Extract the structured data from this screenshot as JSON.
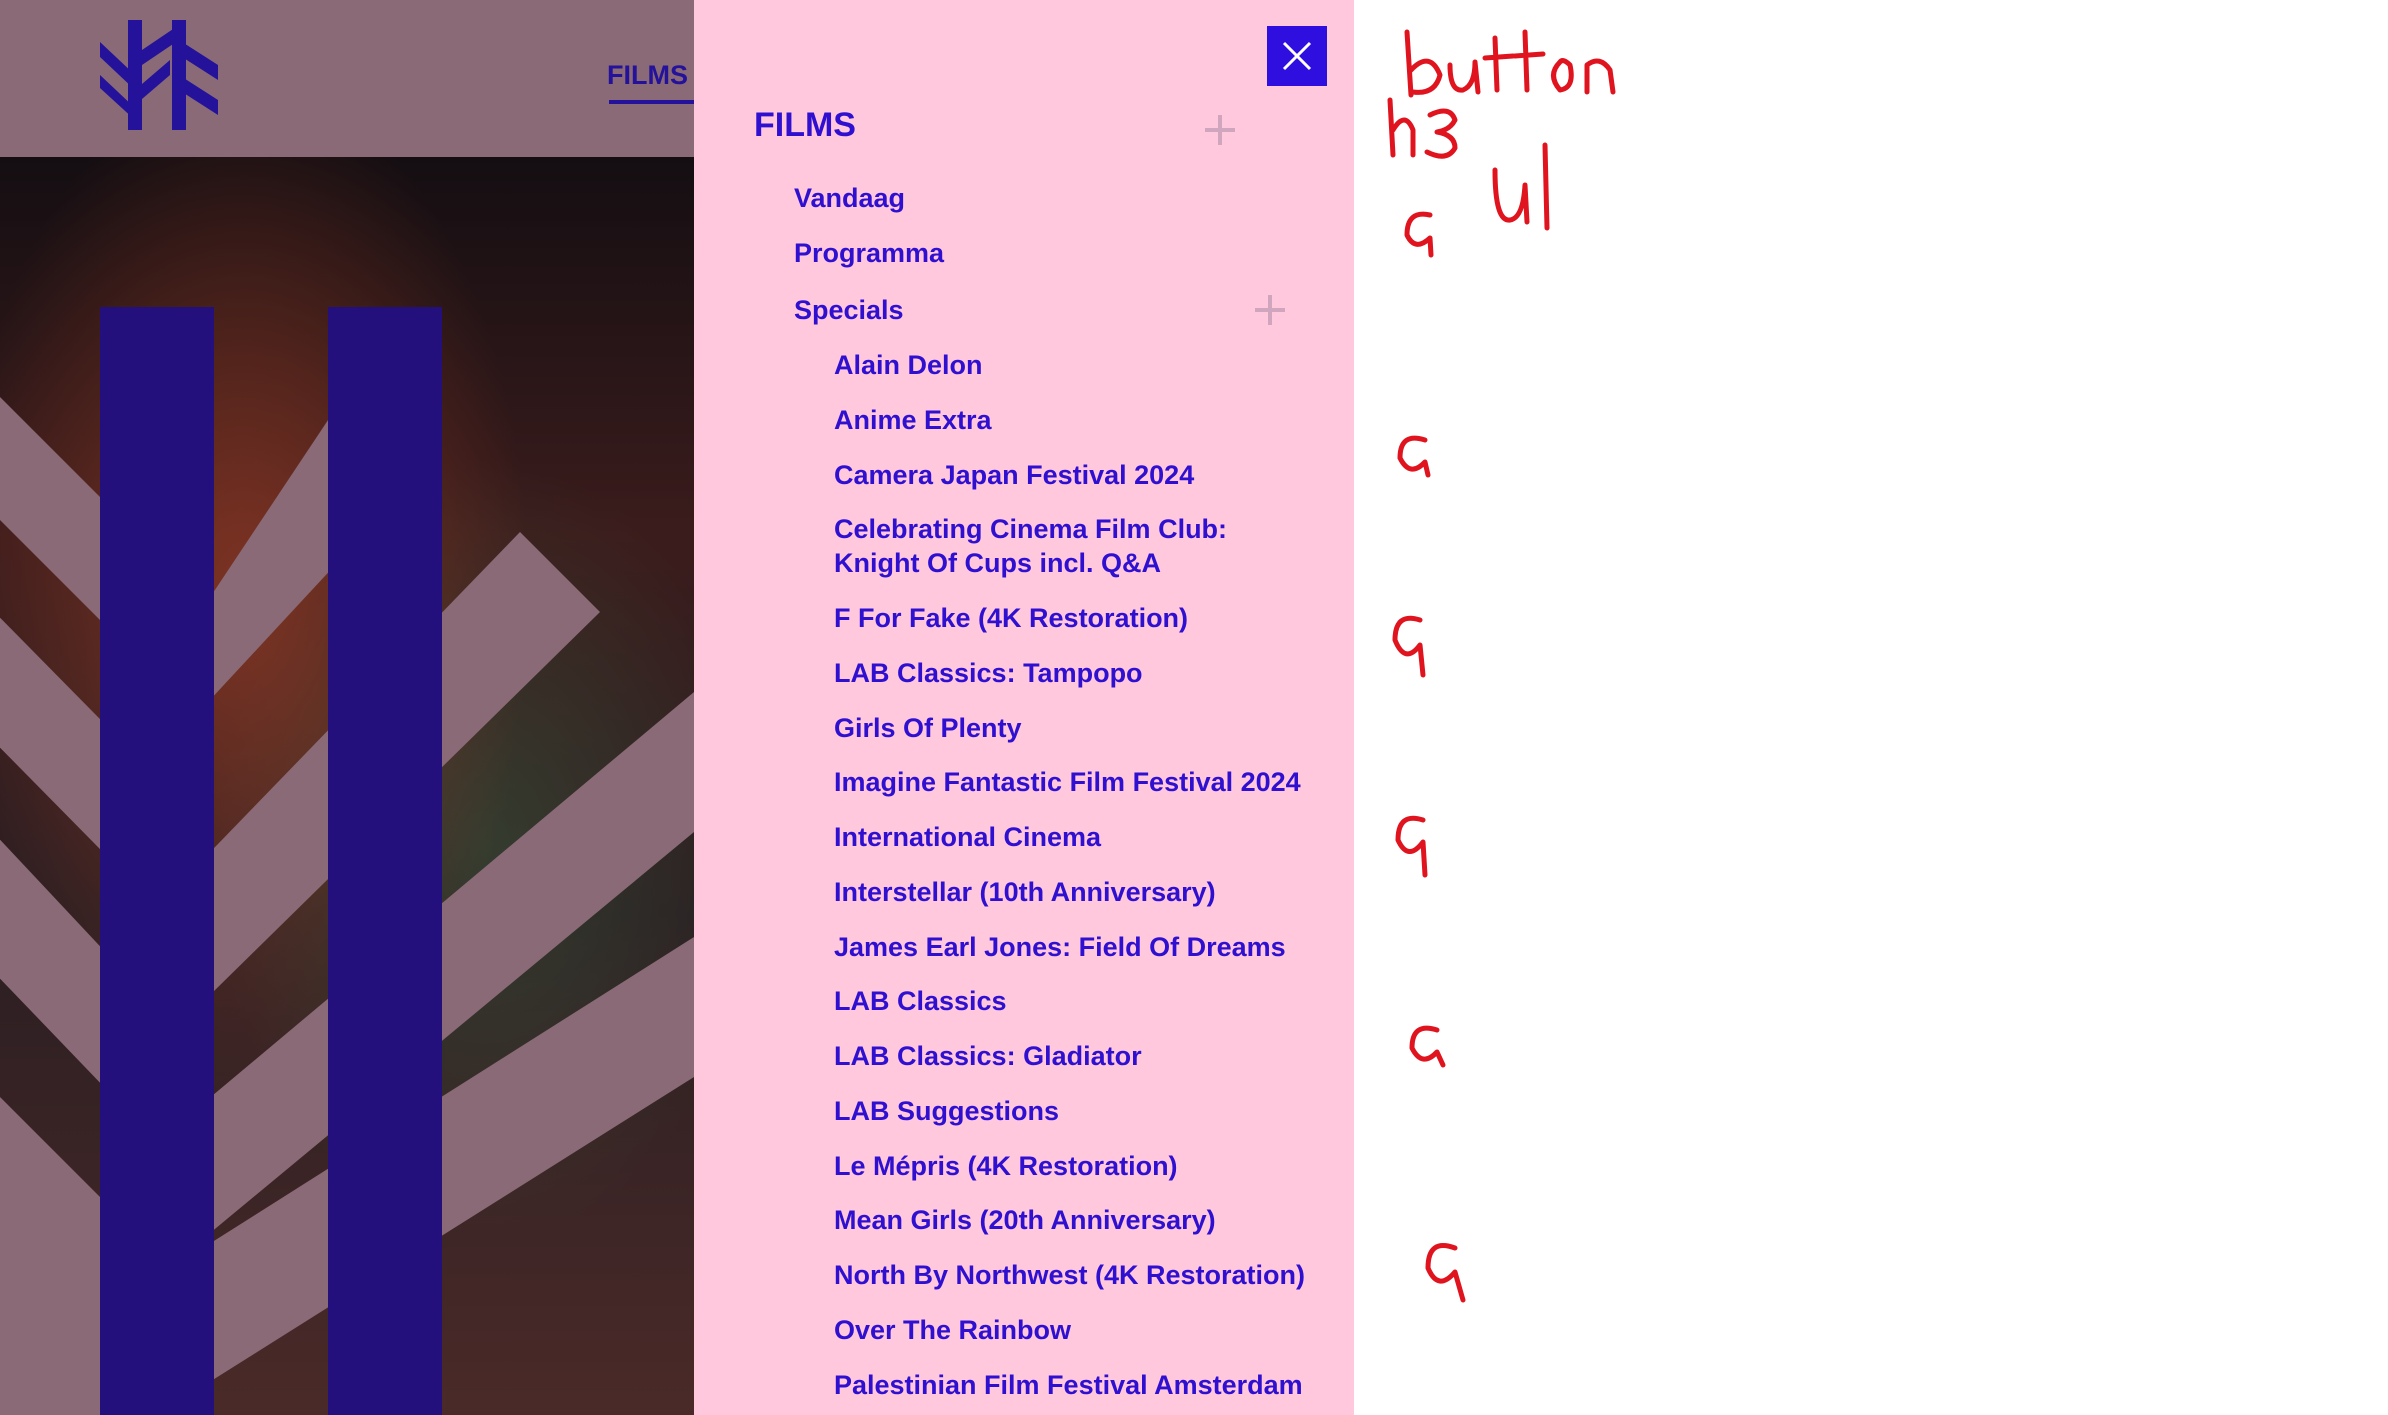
{
  "header": {
    "nav_label": "FILMS"
  },
  "menu": {
    "close_label": "close",
    "heading": "FILMS",
    "items": [
      {
        "label": "Vandaag"
      },
      {
        "label": "Programma"
      },
      {
        "label": "Specials"
      }
    ],
    "specials": [
      {
        "label": "Alain Delon"
      },
      {
        "label": "Anime Extra"
      },
      {
        "label": "Camera Japan Festival 2024"
      },
      {
        "label": "Celebrating Cinema Film Club: Knight Of Cups incl. Q&A"
      },
      {
        "label": "F For Fake (4K Restoration)"
      },
      {
        "label": "LAB Classics: Tampopo"
      },
      {
        "label": "Girls Of Plenty"
      },
      {
        "label": "Imagine Fantastic Film Festival 2024"
      },
      {
        "label": "International Cinema"
      },
      {
        "label": "Interstellar (10th Anniversary)"
      },
      {
        "label": "James Earl Jones: Field Of Dreams"
      },
      {
        "label": "LAB Classics"
      },
      {
        "label": "LAB Classics: Gladiator"
      },
      {
        "label": "LAB Suggestions"
      },
      {
        "label": "Le Mépris (4K Restoration)"
      },
      {
        "label": "Mean Girls (20th Anniversary)"
      },
      {
        "label": "North By Northwest (4K Restoration)"
      },
      {
        "label": "Over The Rainbow"
      },
      {
        "label": "Palestinian Film Festival Amsterdam"
      }
    ]
  },
  "annotations": {
    "button": "button",
    "h3": "h3",
    "ul": "ul",
    "a": "a"
  },
  "colors": {
    "brand_blue": "#2f10d0",
    "panel_pink": "#ffc8dc",
    "close_bg": "#2f0fe0",
    "annotation_red": "#e0141e",
    "logo_navy": "#24129b"
  }
}
